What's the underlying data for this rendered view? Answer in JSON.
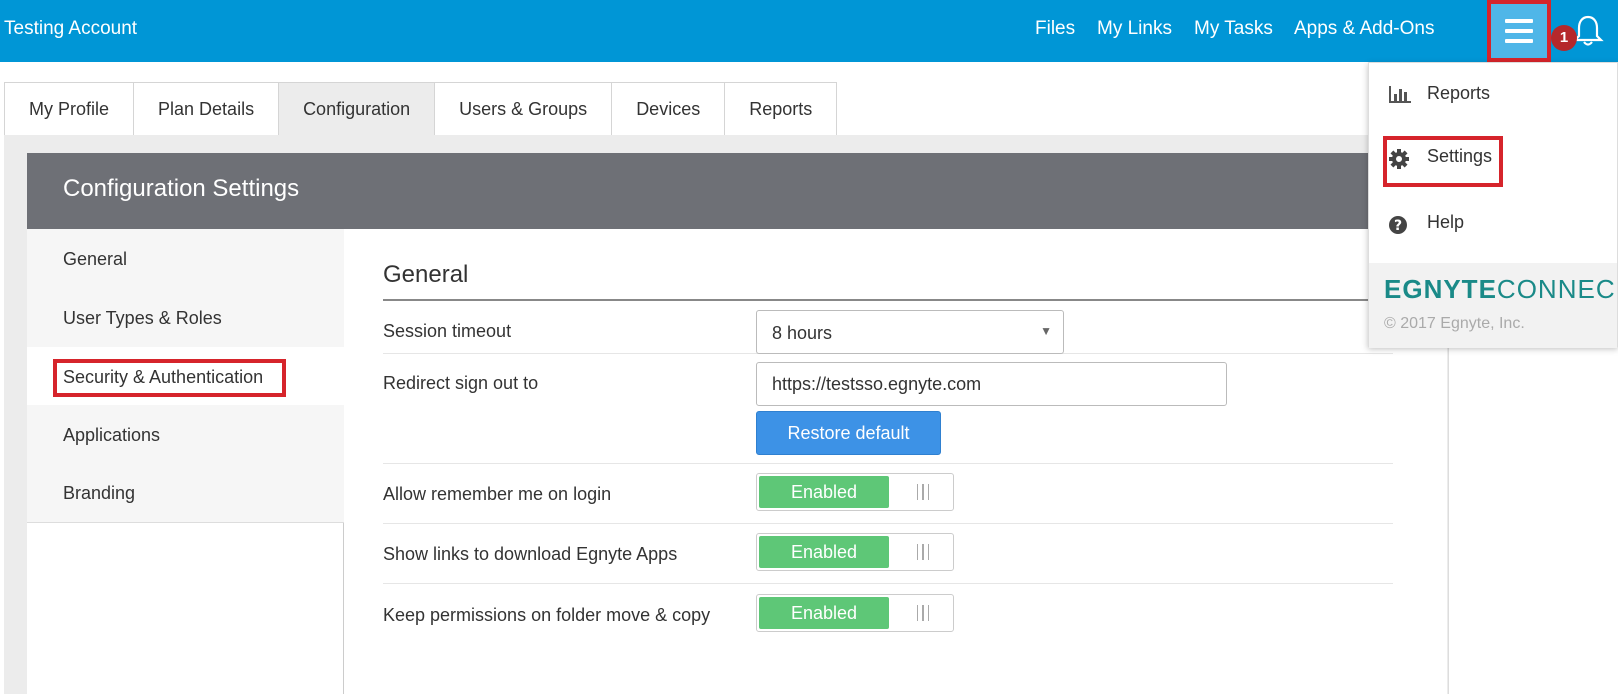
{
  "header": {
    "account_name": "Testing Account",
    "nav": [
      "Files",
      "My Links",
      "My Tasks",
      "Apps & Add-Ons"
    ],
    "notification_count": "1",
    "menu_icon": "hamburger-icon",
    "bell_icon": "bell-icon",
    "color": "#0096d6"
  },
  "tabs": [
    "My Profile",
    "Plan Details",
    "Configuration",
    "Users & Groups",
    "Devices",
    "Reports"
  ],
  "active_tab": "Configuration",
  "config": {
    "title": "Configuration Settings",
    "sidebar": [
      "General",
      "User Types & Roles",
      "Security & Authentication",
      "Applications",
      "Branding"
    ],
    "active_sidebar": "Security & Authentication",
    "section_title": "General",
    "session_timeout": {
      "label": "Session timeout",
      "value": "8 hours"
    },
    "redirect": {
      "label": "Redirect sign out to",
      "value": "https://testsso.egnyte.com",
      "button": "Restore default"
    },
    "toggles": [
      {
        "label": "Allow remember me on login",
        "state": "Enabled"
      },
      {
        "label": "Show links to download Egnyte Apps",
        "state": "Enabled"
      },
      {
        "label": "Keep permissions on folder move & copy",
        "state": "Enabled"
      }
    ],
    "enabled_color": "#5ec777",
    "button_color": "#3d92e6"
  },
  "dropdown": {
    "items": [
      {
        "label": "Reports",
        "icon": "bar-chart-icon"
      },
      {
        "label": "Settings",
        "icon": "gear-icon"
      },
      {
        "label": "Help",
        "icon": "question-circle-icon"
      }
    ],
    "logo": {
      "part1": "EGNYTE",
      "part2": "CONNEC"
    },
    "copyright": "© 2017 Egnyte, Inc."
  }
}
